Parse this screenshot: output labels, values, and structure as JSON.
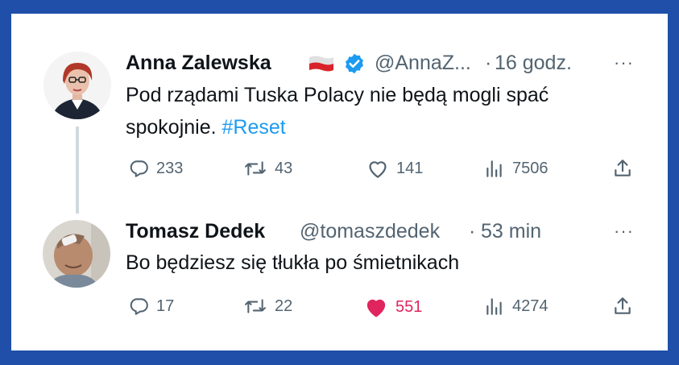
{
  "tweets": [
    {
      "author": "Anna Zalewska",
      "handle": "@AnnaZ...",
      "separator": "·",
      "time": "16 godz.",
      "text_line1": "Pod rządami Tuska Polacy nie będą mogli spać",
      "text_line2": "spokojnie.",
      "hashtag": "#Reset",
      "replies": "233",
      "retweets": "43",
      "likes": "141",
      "views": "7506",
      "liked": false
    },
    {
      "author": "Tomasz Dedek",
      "handle": "@tomaszdedek",
      "separator": "·",
      "time": "53 min",
      "text_line1": "Bo będziesz się tłukła po śmietnikach",
      "replies": "17",
      "retweets": "22",
      "likes": "551",
      "views": "4274",
      "liked": true
    }
  ],
  "more_label": "···",
  "colors": {
    "frame_border": "#1f4fa8",
    "text": "#0f1419",
    "muted": "#536471",
    "hashtag": "#1d9bf0",
    "like_active": "#e0245e",
    "verified": "#1d9bf0"
  },
  "icons": [
    "reply-icon",
    "retweet-icon",
    "like-icon",
    "views-icon",
    "share-icon",
    "verified-badge-icon",
    "poland-flag-icon"
  ]
}
